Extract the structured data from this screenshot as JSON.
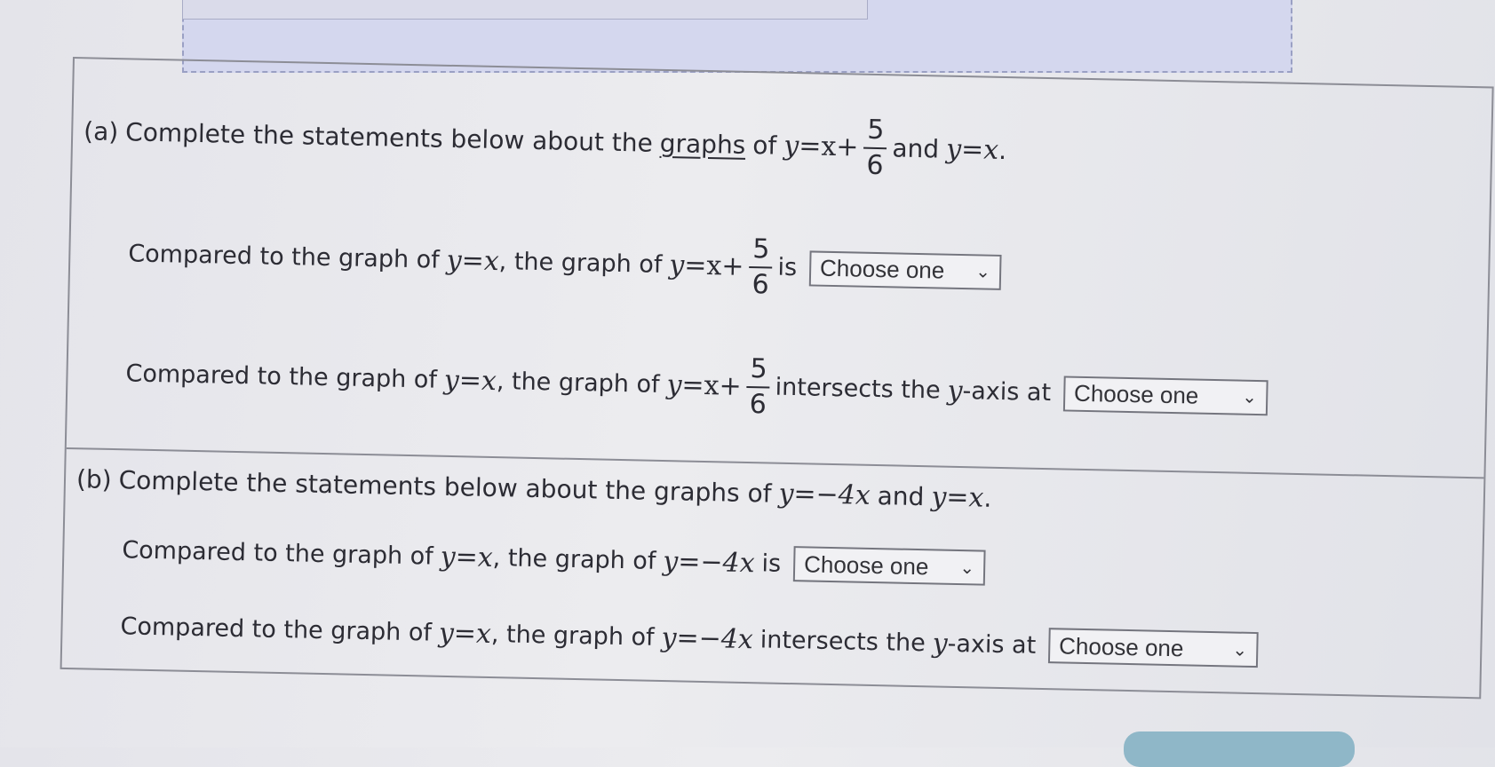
{
  "part_a": {
    "label": "(a)",
    "intro_before": "Complete the statements below about the",
    "intro_link": "graphs",
    "intro_of": "of",
    "intro_and": "and",
    "eq_main_lhs": "y",
    "eq_main_rhs": "=x+",
    "frac_num": "5",
    "frac_den": "6",
    "eq_ref": "y=x",
    "period": ".",
    "s1": {
      "compared": "Compared to the graph of",
      "comma_text": ", the graph of",
      "suffix": "is",
      "select_value": "Choose one"
    },
    "s2": {
      "compared": "Compared to the graph of",
      "comma_text": ", the graph of",
      "suffix_before": "intersects the",
      "suffix_var": "y",
      "suffix_after": "-axis at",
      "select_value": "Choose one"
    }
  },
  "part_b": {
    "label": "(b)",
    "intro_before": "Complete the statements below about the graphs of",
    "intro_and": "and",
    "eq_main": "y=−4x",
    "eq_ref": "y=x",
    "period": ".",
    "s1": {
      "compared": "Compared to the graph of",
      "comma_text": ", the graph of",
      "suffix": "is",
      "select_value": "Choose one"
    },
    "s2": {
      "compared": "Compared to the graph of",
      "comma_text": ", the graph of",
      "suffix_before": "intersects the",
      "suffix_var": "y",
      "suffix_after": "-axis at",
      "select_value": "Choose one"
    }
  },
  "icons": {
    "dropdown": "chevron-down-icon"
  },
  "colors": {
    "background": "#e8e8ec",
    "panel": "#d4d7ee",
    "border": "#8c8d96",
    "text": "#2c2c34"
  }
}
